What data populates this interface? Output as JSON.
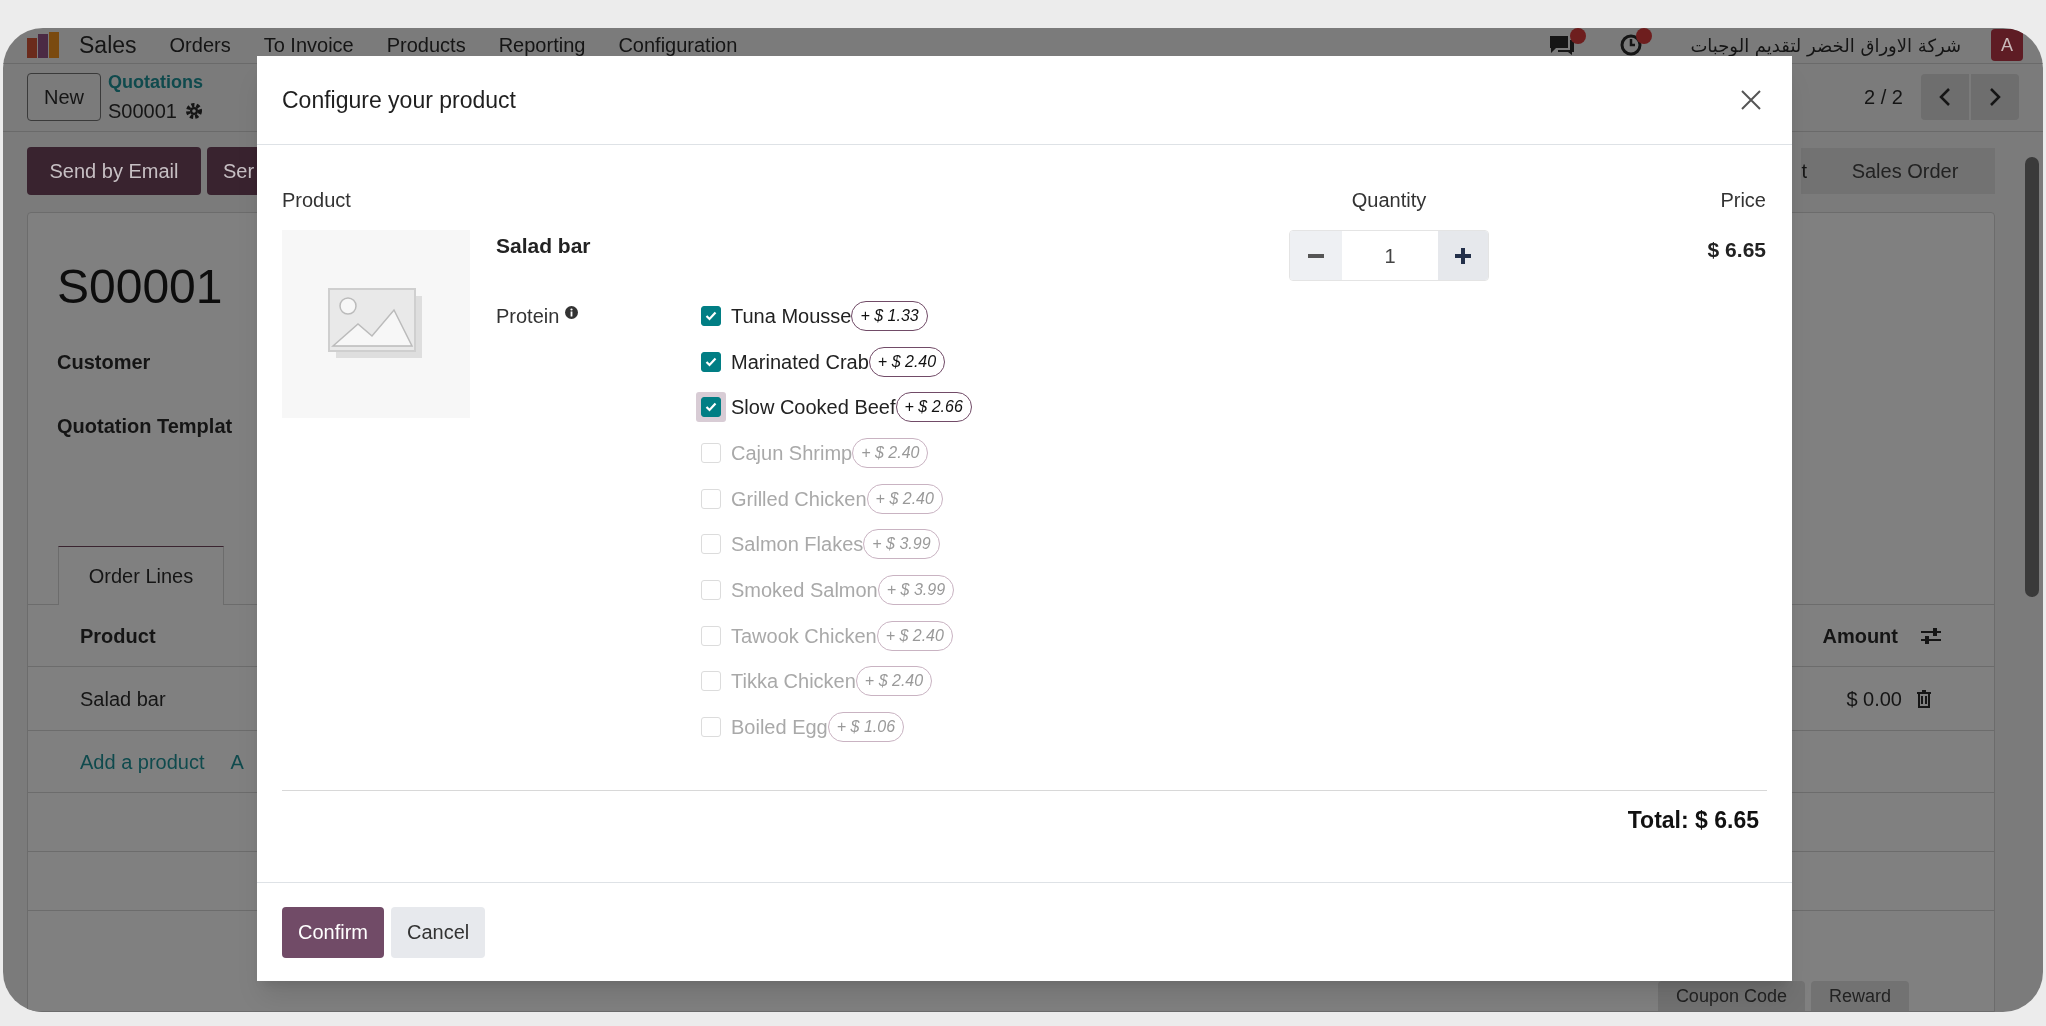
{
  "navbar": {
    "app": "Sales",
    "menu": [
      "Orders",
      "To Invoice",
      "Products",
      "Reporting",
      "Configuration"
    ],
    "company": "شركة الاوراق الخضر لتقديم الوجبات",
    "avatar": "A"
  },
  "control_panel": {
    "new_button": "New",
    "breadcrumb": "Quotations",
    "record": "S00001",
    "pager": "2 / 2"
  },
  "actions": [
    "Send by Email",
    "Ser"
  ],
  "status_bar": [
    "t",
    "Sales Order"
  ],
  "form": {
    "title": "S00001",
    "fields": [
      "Customer",
      "Quotation Templat"
    ],
    "tabs": [
      {
        "label": "Order Lines",
        "selected": true
      }
    ],
    "columns": [
      "Product",
      "Amount"
    ],
    "rows": [
      {
        "product": "Salad bar",
        "amount": "$ 0.00"
      }
    ],
    "add_links": [
      "Add a product",
      "A"
    ],
    "buttons": [
      "Coupon Code",
      "Reward"
    ]
  },
  "dialog": {
    "title": "Configure your product",
    "headers": {
      "product": "Product",
      "quantity": "Quantity",
      "price": "Price"
    },
    "product_name": "Salad bar",
    "quantity": "1",
    "price": "$ 6.65",
    "attribute": "Protein",
    "options": [
      {
        "name": "Tuna Mousse",
        "extra": "+ $ 1.33",
        "checked": true,
        "focused": false
      },
      {
        "name": "Marinated Crab",
        "extra": "+ $ 2.40",
        "checked": true,
        "focused": false
      },
      {
        "name": "Slow Cooked Beef",
        "extra": "+ $ 2.66",
        "checked": true,
        "focused": true
      },
      {
        "name": "Cajun Shrimp",
        "extra": "+ $ 2.40",
        "checked": false,
        "focused": false
      },
      {
        "name": "Grilled Chicken",
        "extra": "+ $ 2.40",
        "checked": false,
        "focused": false
      },
      {
        "name": "Salmon Flakes",
        "extra": "+ $ 3.99",
        "checked": false,
        "focused": false
      },
      {
        "name": "Smoked Salmon",
        "extra": "+ $ 3.99",
        "checked": false,
        "focused": false
      },
      {
        "name": "Tawook Chicken",
        "extra": "+ $ 2.40",
        "checked": false,
        "focused": false
      },
      {
        "name": "Tikka Chicken",
        "extra": "+ $ 2.40",
        "checked": false,
        "focused": false
      },
      {
        "name": "Boiled Egg",
        "extra": "+ $ 1.06",
        "checked": false,
        "focused": false
      }
    ],
    "total": "Total: $ 6.65",
    "buttons": [
      {
        "label": "Confirm",
        "kind": "primary"
      },
      {
        "label": "Cancel",
        "kind": "secondary"
      }
    ]
  }
}
